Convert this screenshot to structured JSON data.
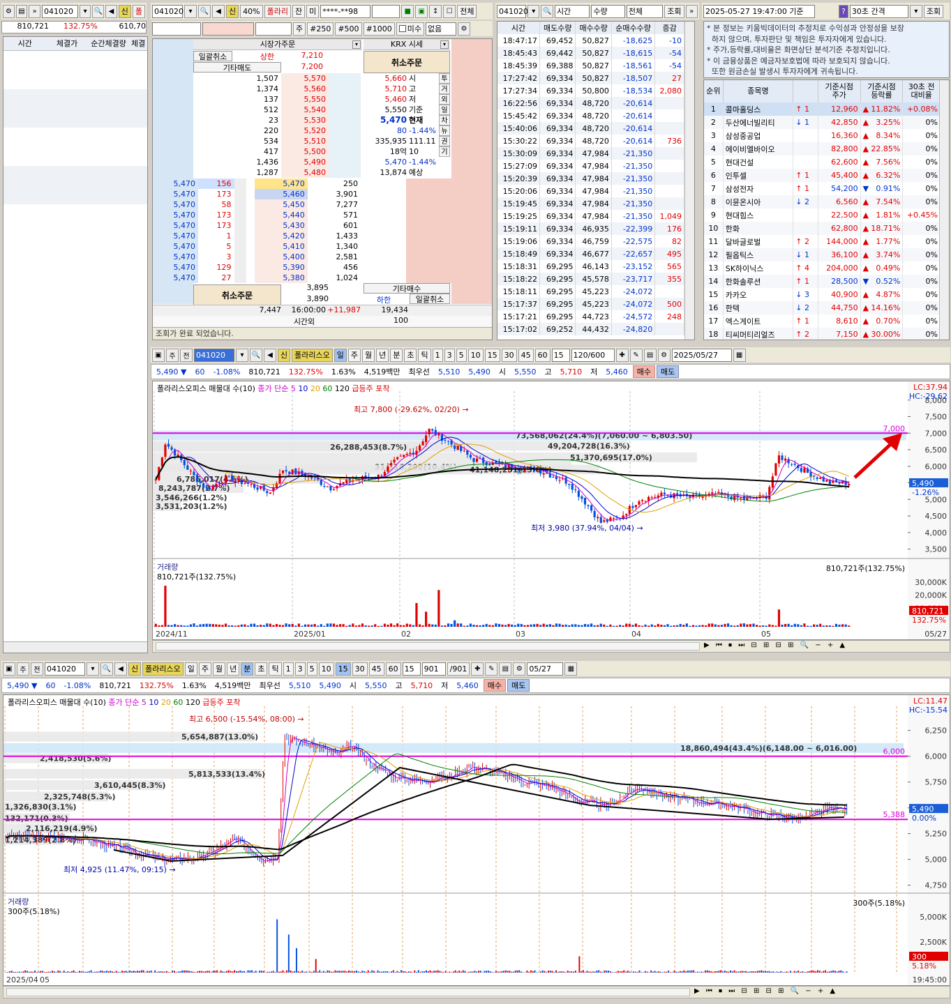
{
  "left": {
    "code": "041020",
    "toggle": "신",
    "tab": "폴",
    "vol": "810,721",
    "rate": "132.75%",
    "vol2": "610,70",
    "cols": [
      "시간",
      "체결가",
      "순간체결량",
      "체결"
    ]
  },
  "order": {
    "code": "041020",
    "badge": "신",
    "badge_pct": "40%",
    "stock_name": "폴라리",
    "tab_jan": "잔",
    "tab_mi": "미",
    "account": "****-**98",
    "all_btn": "전체",
    "qty_unit": "주",
    "q250": "#250",
    "q500": "#500",
    "q1000": "#1000",
    "misu": "미수",
    "none": "없음",
    "market_order": "시장가주문",
    "krx": "KRX 시세",
    "cancel_all": "일괄취소",
    "upper_label": "상한",
    "upper_price": "7,210",
    "other_sell": "기타매도",
    "price_7200": "7,200",
    "cancel_order": "취소주문",
    "other_buy": "기타매수",
    "lower_label": "하한",
    "lower_cancel": "일괄취소",
    "sell_rows": [
      [
        "1,507",
        "5,570"
      ],
      [
        "1,374",
        "5,560"
      ],
      [
        "137",
        "5,550"
      ],
      [
        "512",
        "5,540"
      ],
      [
        "23",
        "5,530"
      ],
      [
        "220",
        "5,520"
      ],
      [
        "534",
        "5,510"
      ],
      [
        "417",
        "5,500"
      ],
      [
        "1,436",
        "5,490"
      ],
      [
        "1,287",
        "5,480"
      ]
    ],
    "info": [
      [
        "5,660",
        "시"
      ],
      [
        "5,710",
        "고"
      ],
      [
        "5,460",
        "저"
      ],
      [
        "5,550",
        "기준"
      ],
      [
        "5,470",
        "현재"
      ],
      [
        "80",
        "-1.44%"
      ],
      [
        "335,935",
        "111.11"
      ],
      [
        "18억",
        "10"
      ],
      [
        "5,470",
        "-1.44%"
      ],
      [
        "13,874",
        "예상"
      ]
    ],
    "side_tabs": [
      "투",
      "거",
      "외",
      "일",
      "차",
      "뉴",
      "권",
      "기"
    ],
    "buy_rows": [
      [
        "5,470",
        "156",
        "5,470",
        "250"
      ],
      [
        "5,470",
        "173",
        "5,460",
        "3,901"
      ],
      [
        "5,470",
        "58",
        "5,450",
        "7,277"
      ],
      [
        "5,470",
        "173",
        "5,440",
        "571"
      ],
      [
        "5,470",
        "173",
        "5,430",
        "601"
      ],
      [
        "5,470",
        "1",
        "5,420",
        "1,433"
      ],
      [
        "5,470",
        "5",
        "5,410",
        "1,340"
      ],
      [
        "5,470",
        "3",
        "5,400",
        "2,581"
      ],
      [
        "5,470",
        "129",
        "5,390",
        "456"
      ],
      [
        "5,470",
        "27",
        "5,380",
        "1,024"
      ]
    ],
    "sum_sell": "3,895",
    "sum_buy_price": "3,890",
    "total_left": "7,447",
    "time": "16:00:00",
    "diff": "+11,987",
    "total_right": "19,434",
    "after_hours": "시간외",
    "after_val": "100",
    "status": "조회가 완료 되었습니다."
  },
  "trades": {
    "code": "041020",
    "sel1": "시간",
    "sel2": "수량",
    "sel3": "전체",
    "query": "조회",
    "cols": [
      "시간",
      "매도수량",
      "매수수량",
      "순매수수량",
      "증감"
    ],
    "rows": [
      [
        "18:47:17",
        "69,452",
        "50,827",
        "-18,625",
        "-10"
      ],
      [
        "18:45:43",
        "69,442",
        "50,827",
        "-18,615",
        "-54"
      ],
      [
        "18:45:39",
        "69,388",
        "50,827",
        "-18,561",
        "-54"
      ],
      [
        "17:27:42",
        "69,334",
        "50,827",
        "-18,507",
        "27"
      ],
      [
        "17:27:34",
        "69,334",
        "50,800",
        "-18,534",
        "2,080"
      ],
      [
        "16:22:56",
        "69,334",
        "48,720",
        "-20,614",
        ""
      ],
      [
        "15:45:42",
        "69,334",
        "48,720",
        "-20,614",
        ""
      ],
      [
        "15:40:06",
        "69,334",
        "48,720",
        "-20,614",
        ""
      ],
      [
        "15:30:22",
        "69,334",
        "48,720",
        "-20,614",
        "736"
      ],
      [
        "15:30:09",
        "69,334",
        "47,984",
        "-21,350",
        ""
      ],
      [
        "15:27:09",
        "69,334",
        "47,984",
        "-21,350",
        ""
      ],
      [
        "15:20:39",
        "69,334",
        "47,984",
        "-21,350",
        ""
      ],
      [
        "15:20:06",
        "69,334",
        "47,984",
        "-21,350",
        ""
      ],
      [
        "15:19:45",
        "69,334",
        "47,984",
        "-21,350",
        ""
      ],
      [
        "15:19:25",
        "69,334",
        "47,984",
        "-21,350",
        "1,049"
      ],
      [
        "15:19:11",
        "69,334",
        "46,935",
        "-22,399",
        "176"
      ],
      [
        "15:19:06",
        "69,334",
        "46,759",
        "-22,575",
        "82"
      ],
      [
        "15:18:49",
        "69,334",
        "46,677",
        "-22,657",
        "495"
      ],
      [
        "15:18:31",
        "69,295",
        "46,143",
        "-23,152",
        "565"
      ],
      [
        "15:18:22",
        "69,295",
        "45,578",
        "-23,717",
        "355"
      ],
      [
        "15:18:11",
        "69,295",
        "45,223",
        "-24,072",
        ""
      ],
      [
        "15:17:37",
        "69,295",
        "45,223",
        "-24,072",
        "500"
      ],
      [
        "15:17:21",
        "69,295",
        "44,723",
        "-24,572",
        "248"
      ],
      [
        "15:17:02",
        "69,252",
        "44,432",
        "-24,820",
        ""
      ]
    ]
  },
  "ranking": {
    "datetime": "2025-05-27 19:47:00 기준",
    "help": "?",
    "interval": "30초 간격",
    "query": "조회",
    "notes": [
      "* 본 정보는 키움빅데이터의 추정치로 수익성과 안정성을 보장",
      "  하지 않으며, 투자판단 및 책임은 투자자에게 있습니다.",
      "* 주가,등락률,대비율은 화면상단 분석기준 추정치입니다.",
      "* 이 금융상품은 예금자보호법에 따라 보호되지 않습니다.",
      "  또한 원금손실 발생시 투자자에게 귀속됩니다."
    ],
    "cols": [
      "순위",
      "종목명",
      "",
      "기준시점\n주가",
      "기준시점\n등락률",
      "30초 전\n대비율"
    ],
    "rows": [
      [
        "1",
        "콜마홀딩스",
        "↑ 1",
        "12,960",
        "▲",
        "11.82%",
        "+0.08%"
      ],
      [
        "2",
        "두산에너빌리티",
        "↓ 1",
        "42,850",
        "▲",
        "3.25%",
        "0%"
      ],
      [
        "3",
        "삼성중공업",
        "",
        "16,360",
        "▲",
        "8.34%",
        "0%"
      ],
      [
        "4",
        "에이비엘바이오",
        "",
        "82,800",
        "▲",
        "22.85%",
        "0%"
      ],
      [
        "5",
        "현대건설",
        "",
        "62,600",
        "▲",
        "7.56%",
        "0%"
      ],
      [
        "6",
        "인투셀",
        "↑ 1",
        "45,400",
        "▲",
        "6.32%",
        "0%"
      ],
      [
        "7",
        "삼성전자",
        "↑ 1",
        "54,200",
        "▼",
        "0.91%",
        "0%"
      ],
      [
        "8",
        "이뮨온시아",
        "↓ 2",
        "6,560",
        "▲",
        "7.54%",
        "0%"
      ],
      [
        "9",
        "현대힘스",
        "",
        "22,500",
        "▲",
        "1.81%",
        "+0.45%"
      ],
      [
        "10",
        "한화",
        "",
        "62,800",
        "▲",
        "18.71%",
        "0%"
      ],
      [
        "11",
        "달바글로벌",
        "↑ 2",
        "144,000",
        "▲",
        "1.77%",
        "0%"
      ],
      [
        "12",
        "필옵틱스",
        "↓ 1",
        "36,100",
        "▲",
        "3.74%",
        "0%"
      ],
      [
        "13",
        "SK하이닉스",
        "↑ 4",
        "204,000",
        "▲",
        "0.49%",
        "0%"
      ],
      [
        "14",
        "한화솔루션",
        "↑ 1",
        "28,500",
        "▼",
        "0.52%",
        "0%"
      ],
      [
        "15",
        "카카오",
        "↓ 3",
        "40,900",
        "▲",
        "4.87%",
        "0%"
      ],
      [
        "16",
        "한텍",
        "↓ 2",
        "44,750",
        "▲",
        "14.16%",
        "0%"
      ],
      [
        "17",
        "엑스게이트",
        "↑ 1",
        "8,610",
        "▲",
        "0.70%",
        "0%"
      ],
      [
        "18",
        "티씨머티리얼즈",
        "↑ 2",
        "7,150",
        "▲",
        "30.00%",
        "0%"
      ]
    ]
  },
  "chart1": {
    "code": "041020",
    "badge": "신",
    "name": "폴라리스오",
    "periods": [
      "일",
      "주",
      "월",
      "년",
      "분",
      "초",
      "틱"
    ],
    "nums": [
      "1",
      "3",
      "5",
      "10",
      "15",
      "30",
      "45",
      "60"
    ],
    "n15": "15",
    "count": "120/600",
    "date": "2025/05/27",
    "price": "5,490",
    "change": "60",
    "change_pct": "-1.08%",
    "vol": "810,721",
    "vol_pct": "132.75%",
    "turn": "1.63%",
    "amount": "4,519백만",
    "best_label": "최우선",
    "best_ask": "5,510",
    "best_bid": "5,490",
    "open_l": "시",
    "open": "5,550",
    "high_l": "고",
    "high": "5,710",
    "low_l": "저",
    "low": "5,460",
    "buy": "매수",
    "sell": "매도",
    "legend": "폴라리스오피스 매물대 수(10)",
    "ma_label": "종가 단순",
    "ma": [
      "5",
      "10",
      "20",
      "60",
      "120"
    ],
    "surge": "급등주 포착",
    "lc": "LC:37.94",
    "hc": "HC:-29.62",
    "hi_note": "최고 7,800 (-29.62%, 02/20)",
    "lo_note": "최저 3,980 (37.94%, 04/04)",
    "line_label": "7,000",
    "cur_tag": "5,490",
    "cur_pct": "-1.26%",
    "profile_labels": [
      "73,568,062(24.4%)(7,060.00 ~ 6,803.50)",
      "49,204,728(16.3%)",
      "26,288,453(8.7%)",
      "51,370,695(17.0%)",
      "31,316,292(10.4%)",
      "41,148,251(13.6%)",
      "6,786,017(4.6%)",
      "8,243,787(2.7%)",
      "3,546,266(1.2%)",
      "3,531,203(1.2%)"
    ],
    "yticks": [
      "8,000",
      "7,500",
      "7,000",
      "6,500",
      "6,000",
      "5,500",
      "5,000",
      "4,500",
      "4,000",
      "3,500"
    ],
    "vol_title": "거래량",
    "vol_note": "810,721주(132.75%)",
    "vol_ticks": [
      "30,000K",
      "20,000K",
      "10,000K"
    ],
    "vol_tag": "810,721",
    "vol_tag2": "132.75%",
    "xticks": [
      "2024/11",
      "2025/01",
      "02",
      "03",
      "04",
      "05"
    ],
    "xend": "05/27"
  },
  "chart2": {
    "code": "041020",
    "badge": "신",
    "name": "폴라리스오",
    "periods": [
      "일",
      "주",
      "월",
      "년",
      "분",
      "초",
      "틱"
    ],
    "nums": [
      "1",
      "3",
      "5",
      "10",
      "15",
      "30",
      "45",
      "60"
    ],
    "n15": "15",
    "count": "901",
    "count_total": "/901",
    "date": "05/27",
    "price": "5,490",
    "change": "60",
    "change_pct": "-1.08%",
    "vol": "810,721",
    "vol_pct": "132.75%",
    "turn": "1.63%",
    "amount": "4,519백만",
    "best_label": "최우선",
    "best_ask": "5,510",
    "best_bid": "5,490",
    "open_l": "시",
    "open": "5,550",
    "high_l": "고",
    "high": "5,710",
    "low_l": "저",
    "low": "5,460",
    "buy": "매수",
    "sell": "매도",
    "legend": "폴라리스오피스 매물대 수(10)",
    "ma_label": "종가 단순",
    "ma": [
      "5",
      "10",
      "20",
      "60",
      "120"
    ],
    "surge": "급등주 포착",
    "lc": "LC:11.47",
    "hc": "HC:-15.54",
    "hi_note": "최고 6,500 (-15.54%, 08:00)",
    "lo_note": "최저 4,925 (11.47%, 09:15)",
    "line_label": "6,000",
    "line_label2": "5,388",
    "cur_tag": "5,490",
    "cur_pct": "0.00%",
    "profile_labels": [
      "5,654,887(13.0%)",
      "18,860,494(43.4%)(6,148.00 ~ 6,016.00)",
      "2,418,530(5.6%)",
      "5,813,533(13.4%)",
      "3,610,445(8.3%)",
      "2,325,748(5.3%)",
      "1,326,830(3.1%)",
      "132,171(0.3%)",
      "2,116,219(4.9%)",
      "1,214,389(2.8%)"
    ],
    "yticks": [
      "6,250",
      "6,000",
      "5,750",
      "5,500",
      "5,250",
      "5,000",
      "4,750"
    ],
    "vol_title": "거래량",
    "vol_note": "300주(5.18%)",
    "vol_note_r": "300주(5.18%)",
    "vol_ticks": [
      "5,000K",
      "2,500K"
    ],
    "vol_tag": "300",
    "vol_tag2": "5.18%",
    "xticks": [
      "2025/04",
      "05"
    ],
    "xend": "19:45:00"
  }
}
